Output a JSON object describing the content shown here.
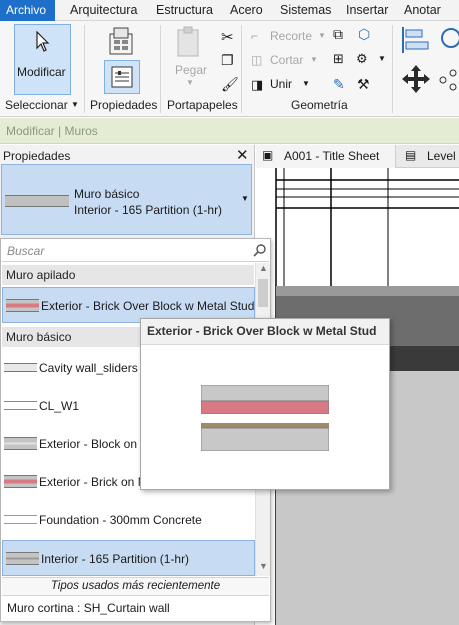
{
  "menu": {
    "tabs": [
      "Archivo",
      "Arquitectura",
      "Estructura",
      "Acero",
      "Sistemas",
      "Insertar",
      "Anotar"
    ]
  },
  "ribbon": {
    "modify_label": "Modificar",
    "paste_label": "Pegar",
    "trim_label": "Recorte",
    "cut_label": "Cortar",
    "join_label": "Unir",
    "groups": {
      "select": "Seleccionar",
      "properties": "Propiedades",
      "clipboard": "Portapapeles",
      "geometry": "Geometría"
    }
  },
  "context_bar": {
    "text": "Modificar | Muros"
  },
  "properties": {
    "title": "Propiedades",
    "selector_family": "Muro básico",
    "selector_type": "Interior - 165 Partition (1-hr)"
  },
  "view_tabs": [
    "A001 - Title Sheet",
    "Level"
  ],
  "dropdown": {
    "search_placeholder": "Buscar",
    "group_stacked": "Muro apilado",
    "stacked_items": [
      "Exterior - Brick Over Block w Metal Stud"
    ],
    "group_basic": "Muro básico",
    "basic_items": [
      "Cavity wall_sliders",
      "CL_W1",
      "Exterior - Block on",
      "Exterior - Brick on M",
      "Foundation - 300mm Concrete",
      "Interior - 165 Partition (1-hr)"
    ],
    "recent_label": "Tipos usados más recientemente",
    "recent_item": "Muro cortina : SH_Curtain wall"
  },
  "tooltip": {
    "title": "Exterior - Brick Over Block w Metal Stud"
  },
  "colors": {
    "accent": "#1e6fc9",
    "selection": "#c7dcf3",
    "brick": "#d77a84",
    "context_bar": "#e4edd4"
  }
}
